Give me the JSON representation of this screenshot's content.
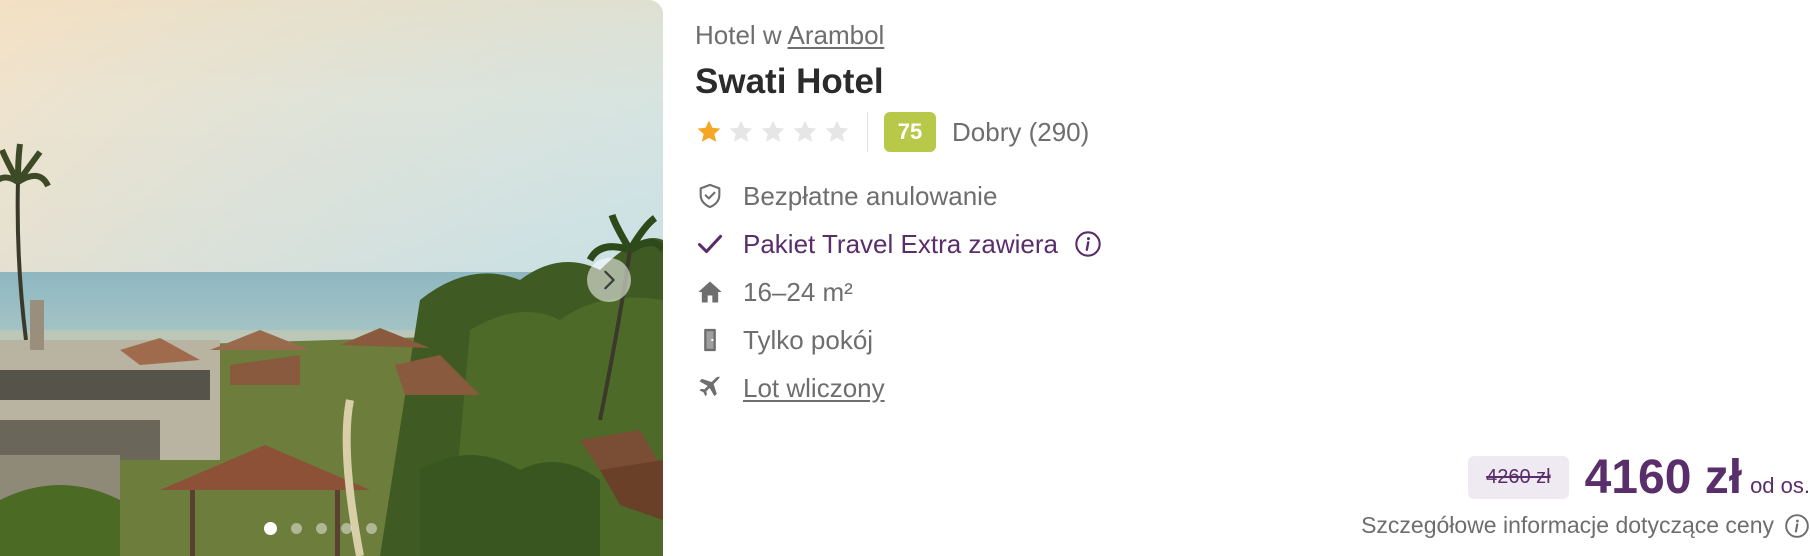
{
  "hotel": {
    "location_prefix": "Hotel w",
    "location_link": "Arambol",
    "name": "Swati Hotel",
    "stars_filled": 1,
    "stars_total": 5,
    "score": "75",
    "rating_label": "Dobry (290)"
  },
  "features": [
    {
      "icon": "shield-check-icon",
      "label": "Bezpłatne anulowanie"
    },
    {
      "icon": "check-icon",
      "label": "Pakiet Travel Extra zawiera"
    },
    {
      "icon": "house-icon",
      "label": "16–24 m²"
    },
    {
      "icon": "door-icon",
      "label": "Tylko pokój"
    },
    {
      "icon": "plane-icon",
      "label": "Lot wliczony"
    }
  ],
  "pricing": {
    "old_price": "4260 zł",
    "price": "4160 zł",
    "per_person": "od os.",
    "details_link": "Szczegółowe informacje dotyczące ceny"
  },
  "gallery": {
    "slide_count": 5,
    "active_slide": 1
  },
  "colors": {
    "brand_purple": "#5a2d6b",
    "score_green": "#b8c94a",
    "star_filled": "#f5a623",
    "star_empty": "#e6e6e6"
  }
}
